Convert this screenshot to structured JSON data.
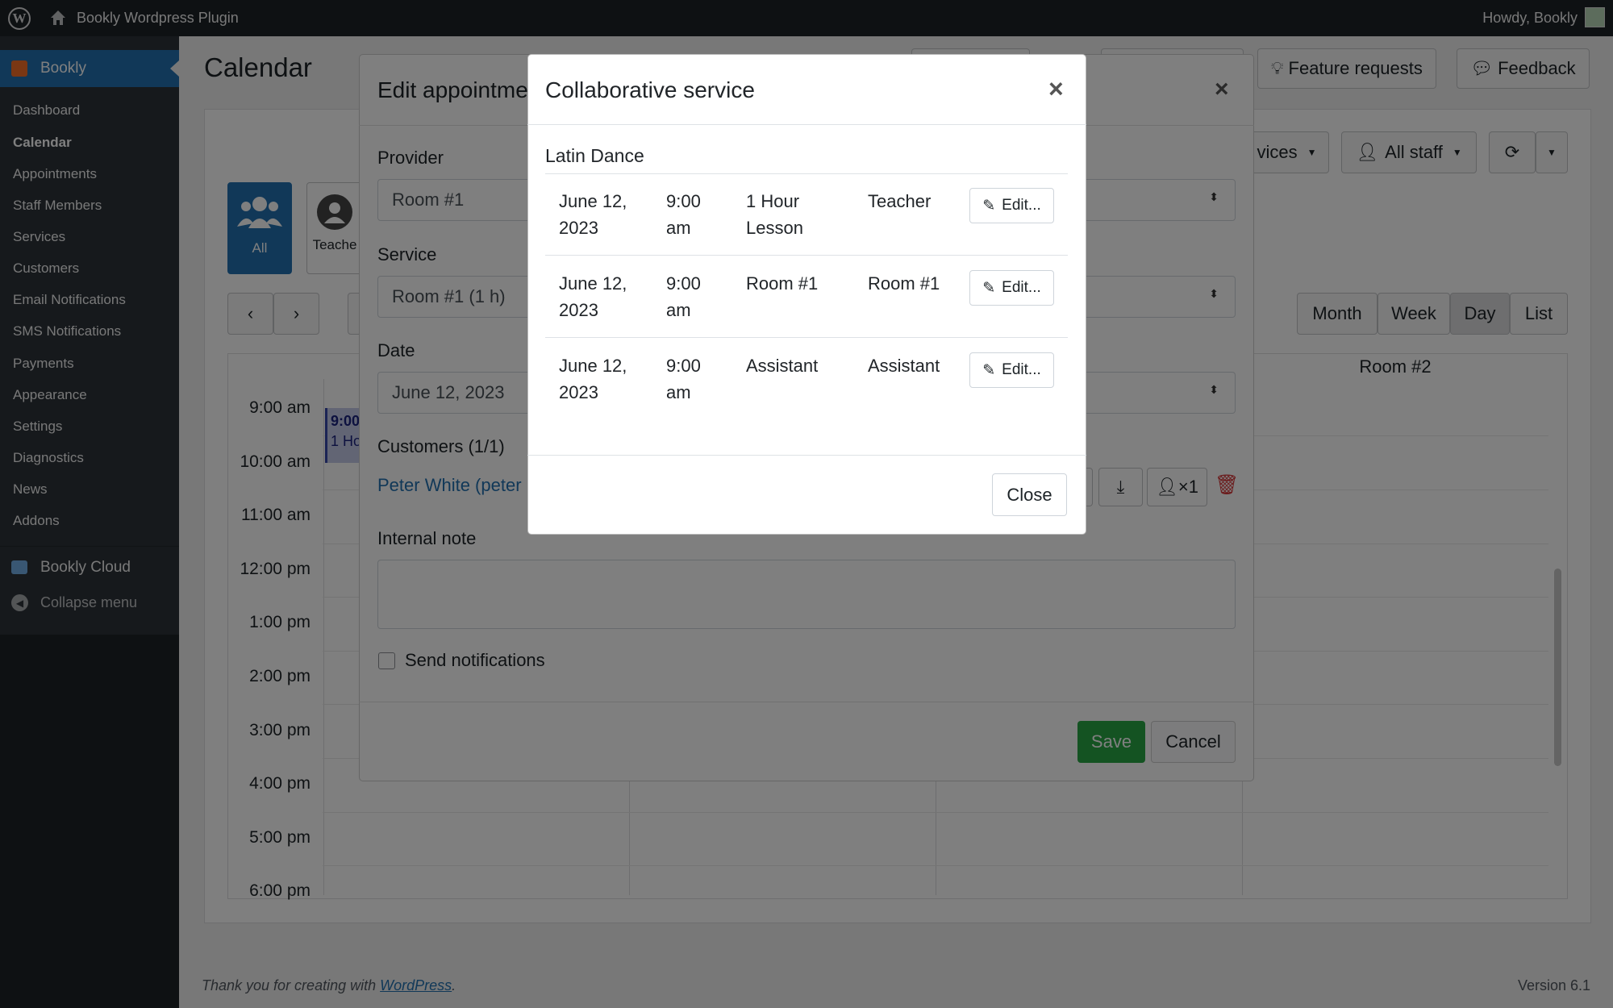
{
  "adminbar": {
    "logo": "W",
    "site_name": "Bookly Wordpress Plugin",
    "howdy": "Howdy, Bookly"
  },
  "sidebar": {
    "plugin_label": "Bookly",
    "items": [
      "Dashboard",
      "Calendar",
      "Appointments",
      "Staff Members",
      "Services",
      "Customers",
      "Email Notifications",
      "SMS Notifications",
      "Payments",
      "Appearance",
      "Settings",
      "Diagnostics",
      "News",
      "Addons"
    ],
    "current": "Calendar",
    "cloud_label": "Bookly Cloud",
    "collapse_label": "Collapse menu"
  },
  "page": {
    "title": "Calendar",
    "feature_requests": "Feature requests",
    "feedback": "Feedback",
    "services_filter": "vices",
    "staff_filter": "All staff",
    "staff_all": "All",
    "staff_teacher": "Teache",
    "views": [
      "Month",
      "Week",
      "Day",
      "List"
    ],
    "active_view": "Day",
    "column_room2": "Room #2",
    "times": [
      "9:00 am",
      "10:00 am",
      "11:00 am",
      "12:00 pm",
      "1:00 pm",
      "2:00 pm",
      "3:00 pm",
      "4:00 pm",
      "5:00 pm",
      "6:00 pm"
    ],
    "event_time": "9:00",
    "event_label": "1 Ho",
    "footer_text": "Thank you for creating with",
    "footer_link": "WordPress",
    "footer_period": ".",
    "version": "Version 6.1"
  },
  "edit_modal": {
    "title": "Edit appointme",
    "provider_label": "Provider",
    "provider_value": "Room #1",
    "service_label": "Service",
    "service_value": "Room #1 (1 h)",
    "date_label": "Date",
    "date_value": "June 12, 2023",
    "customers_label": "Customers (1/1)",
    "customer_link": "Peter White (peter",
    "customer_count": "×1",
    "internal_note_label": "Internal note",
    "send_notifications": "Send notifications",
    "save": "Save",
    "cancel": "Cancel"
  },
  "collab_modal": {
    "title": "Collaborative service",
    "close_x": "×",
    "group": "Latin Dance",
    "rows": [
      {
        "date1": "June 12,",
        "date2": "2023",
        "time1": "9:00",
        "time2": "am",
        "service1": "1 Hour",
        "service2": "Lesson",
        "staff": "Teacher",
        "edit": "Edit..."
      },
      {
        "date1": "June 12,",
        "date2": "2023",
        "time1": "9:00",
        "time2": "am",
        "service1": "Room #1",
        "service2": "",
        "staff": "Room #1",
        "edit": "Edit..."
      },
      {
        "date1": "June 12,",
        "date2": "2023",
        "time1": "9:00",
        "time2": "am",
        "service1": "Assistant",
        "service2": "",
        "staff": "Assistant",
        "edit": "Edit..."
      }
    ],
    "close_button": "Close"
  },
  "colors": {
    "accent": "#2271b1",
    "admin_dark": "#1d2327",
    "save_green": "#28a745",
    "delete_red": "#d63638"
  }
}
